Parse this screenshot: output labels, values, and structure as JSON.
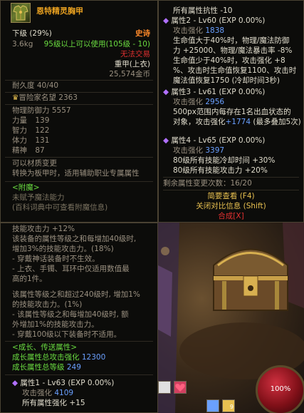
{
  "item": {
    "name": "恩特精灵胸甲",
    "grade": "下级 (29%)",
    "rarity": "史诗",
    "weight": "3.6kg",
    "level_req": "95级以上可以使用(105级 - 10)",
    "trade": "无法交易",
    "armor_type": "重甲(上衣)",
    "price": "25,574金币",
    "durability": "耐久度 40/40",
    "adventure_fame_label": "冒险家名望",
    "adventure_fame_value": "2363"
  },
  "stats": [
    {
      "label": "物理防御力",
      "value": "5557"
    },
    {
      "label": "力量",
      "value": "139"
    },
    {
      "label": "智力",
      "value": "122"
    },
    {
      "label": "体力",
      "value": "131"
    },
    {
      "label": "精神",
      "value": "87"
    }
  ],
  "material_change": {
    "line1": "可以材质变更",
    "line2": "转换为板甲时，适用辅助职业专属属性"
  },
  "enchant": {
    "header": "<附魔>",
    "line1": "未赋予魔法能力",
    "line2": "(百科词典中可查看附魔信息)"
  },
  "skill_text": [
    "技能攻击力 +12%",
    "该装备的属性等级之和每增加40级时,",
    "增加3%的技能攻击力。(18%)",
    "- 穿戴神话装备时不生效。",
    "- 上衣、手镯、耳环中仅适用数值最",
    "高的1件。",
    "",
    "该属性等级之和超过240级时, 增加1%",
    "的技能攻击力。(1%)",
    "- 该属性等级之和每增加40级时, 额",
    "外增加1%的技能攻击力。",
    "- 穿戴100级以下装备时不适用。"
  ],
  "growth": {
    "header": "<成长、传送属性>",
    "atk_label": "成长属性总攻击强化",
    "atk_value": "12300",
    "level_label": "成长属性总等级",
    "level_value": "249"
  },
  "attr1": {
    "header": "属性1 - Lv63 (EXP 0.00%)",
    "atk_label": "攻击强化",
    "atk_value": "4109",
    "line": "所有属性强化 +15"
  },
  "right": {
    "top_line": "所有属性抗性 -10",
    "attr2_header": "属性2 - Lv60 (EXP 0.00%)",
    "attr2_atk_label": "攻击强化",
    "attr2_atk_value": "1838",
    "attr2_desc": [
      "生命值大于40%时，物理/魔法防御",
      "力 +25000、物理/魔法暴击率 -8%",
      "生命值少于40%时，攻击强化 +8",
      "%、攻击时生命值恢复1100、攻击时",
      "魔法值恢复1750 (冷却时间3秒)"
    ],
    "attr3_header": "属性3 - Lv61 (EXP 0.00%)",
    "attr3_atk_label": "攻击强化",
    "attr3_atk_value": "2956",
    "attr3_desc1": "500px范围内每存在1名出血状态的",
    "attr3_desc2": "对象，攻击强化",
    "attr3_desc2_val": "+1774",
    "attr3_desc2_tail": "(最多叠加5次)",
    "attr4_header": "属性4 - Lv65 (EXP 0.00%)",
    "attr4_atk_label": "攻击强化",
    "attr4_atk_value": "3397",
    "attr4_line1": "80级所有技能冷却时间 +30%",
    "attr4_line2": "80级所有技能攻击力 +20%",
    "remaining": "剩余属性变更次数：16/20",
    "link1": "简要查看 (F4)",
    "link2": "关闭对比信息 (Shift)",
    "link3": "合成[X]"
  },
  "hud": {
    "hp_percent": "100%",
    "skill_count": "9"
  },
  "colors": {
    "gold": "#e8c050",
    "orange": "#ff8a2a",
    "green": "#6adc40",
    "blue": "#6aa0ff",
    "purple": "#b070ff",
    "red": "#e03030"
  }
}
